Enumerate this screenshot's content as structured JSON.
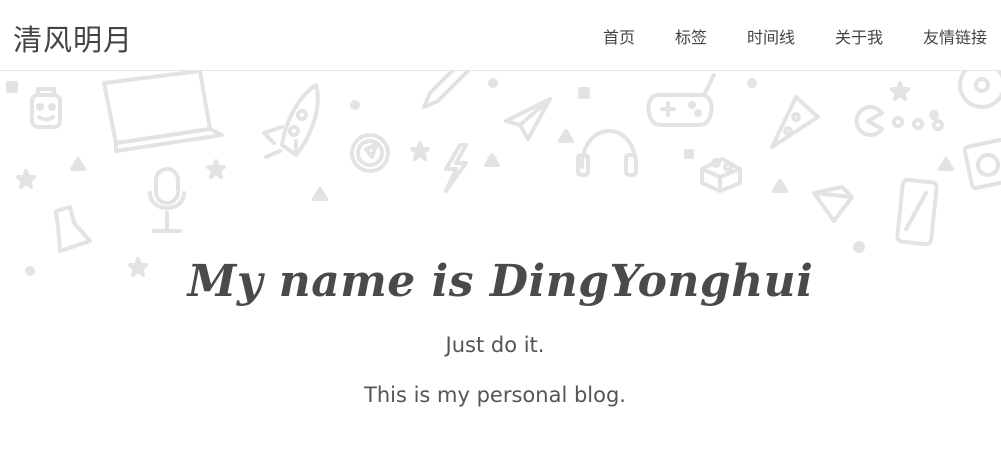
{
  "nav": {
    "brand": "清风明月",
    "links": [
      "首页",
      "标签",
      "时间线",
      "关于我",
      "友情链接"
    ]
  },
  "hero": {
    "title": "My name is DingYonghui",
    "motto": "Just do it.",
    "description": "This is my personal blog."
  },
  "colors": {
    "text": "#555555",
    "doodle": "#e3e3e3",
    "navbar_border": "#e6e6e6"
  },
  "icons": [
    "robot-head-icon",
    "laptop-icon",
    "rocket-icon",
    "pencil-icon",
    "paper-plane-icon",
    "gamepad-icon",
    "pizza-slice-icon",
    "pacman-icon",
    "cd-icon",
    "compass-icon",
    "lightning-icon",
    "headphones-icon",
    "lego-brick-icon",
    "camera-icon",
    "microphone-icon",
    "flask-icon",
    "diamond-icon",
    "smartphone-icon"
  ]
}
